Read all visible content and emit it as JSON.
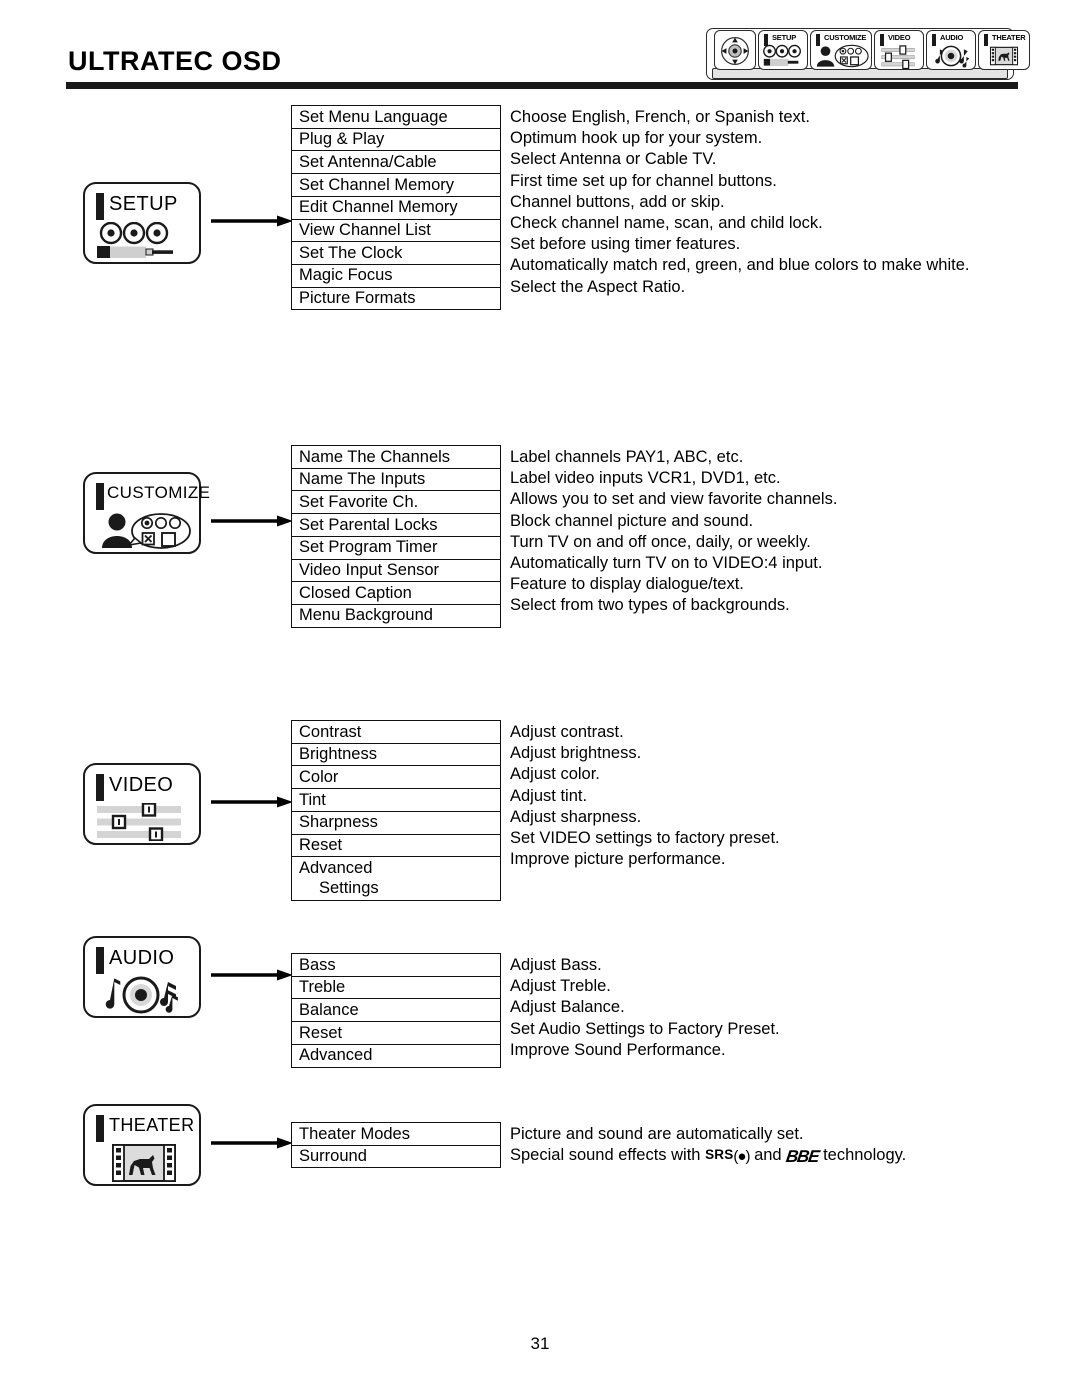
{
  "header": {
    "title": "ULTRATEC OSD"
  },
  "iconbar": {
    "name": "osd-navigation-bar",
    "tabs": [
      {
        "label": "",
        "icon": "dpad-icon"
      },
      {
        "label": "SETUP",
        "icon": "rca-jacks-cable-icon"
      },
      {
        "label": "CUSTOMIZE",
        "icon": "person-options-icon"
      },
      {
        "label": "VIDEO",
        "icon": "sliders-icon"
      },
      {
        "label": "AUDIO",
        "icon": "speaker-music-notes-icon"
      },
      {
        "label": "THEATER",
        "icon": "film-strip-horse-icon"
      }
    ]
  },
  "sections": [
    {
      "id": "setup",
      "icon_label": "SETUP",
      "icon_name": "rca-jacks-cable-icon",
      "items": [
        {
          "label": "Set Menu Language",
          "desc": "Choose English, French, or Spanish text."
        },
        {
          "label": "Plug & Play",
          "desc": "Optimum hook up for your system."
        },
        {
          "label": "Set Antenna/Cable",
          "desc": "Select Antenna or Cable TV."
        },
        {
          "label": "Set Channel Memory",
          "desc": "First time set up for channel buttons."
        },
        {
          "label": "Edit Channel Memory",
          "desc": "Channel buttons, add or skip."
        },
        {
          "label": "View Channel List",
          "desc": "Check channel name, scan, and child lock."
        },
        {
          "label": "Set The Clock",
          "desc": "Set before using timer features."
        },
        {
          "label": "Magic Focus",
          "desc": "Automatically match red, green, and blue colors to make white."
        },
        {
          "label": "Picture Formats",
          "desc": "Select  the Aspect Ratio."
        }
      ]
    },
    {
      "id": "customize",
      "icon_label": "CUSTOMIZE",
      "icon_name": "person-options-icon",
      "items": [
        {
          "label": "Name The Channels",
          "desc": "Label channels PAY1, ABC, etc."
        },
        {
          "label": "Name The Inputs",
          "desc": "Label video inputs VCR1, DVD1, etc."
        },
        {
          "label": "Set Favorite Ch.",
          "desc": "Allows you to set and view favorite channels."
        },
        {
          "label": "Set Parental Locks",
          "desc": "Block channel picture and sound."
        },
        {
          "label": "Set Program Timer",
          "desc": "Turn TV on and off once, daily, or weekly."
        },
        {
          "label": "Video Input Sensor",
          "desc": "Automatically turn TV on to VIDEO:4 input."
        },
        {
          "label": "Closed Caption",
          "desc": "Feature to display dialogue/text."
        },
        {
          "label": "Menu Background",
          "desc": "Select from two types of backgrounds."
        }
      ]
    },
    {
      "id": "video",
      "icon_label": "VIDEO",
      "icon_name": "sliders-icon",
      "items": [
        {
          "label": "Contrast",
          "desc": "Adjust contrast."
        },
        {
          "label": "Brightness",
          "desc": "Adjust brightness."
        },
        {
          "label": "Color",
          "desc": "Adjust color."
        },
        {
          "label": "Tint",
          "desc": "Adjust tint."
        },
        {
          "label": "Sharpness",
          "desc": "Adjust sharpness."
        },
        {
          "label": "Reset",
          "desc": "Set VIDEO settings to factory preset."
        },
        {
          "label": "Advanced",
          "label2": "Settings",
          "desc": "Improve picture performance."
        }
      ]
    },
    {
      "id": "audio",
      "icon_label": "AUDIO",
      "icon_name": "speaker-music-notes-icon",
      "items": [
        {
          "label": "Bass",
          "desc": "Adjust Bass."
        },
        {
          "label": "Treble",
          "desc": "Adjust Treble."
        },
        {
          "label": "Balance",
          "desc": "Adjust Balance."
        },
        {
          "label": "Reset",
          "desc": "Set Audio Settings to Factory Preset."
        },
        {
          "label": "Advanced",
          "desc": "Improve Sound Performance."
        }
      ]
    },
    {
      "id": "theater",
      "icon_label": "THEATER",
      "icon_name": "film-strip-horse-icon",
      "items": [
        {
          "label": "Theater Modes",
          "desc": "Picture and sound are automatically set."
        },
        {
          "label": "Surround",
          "desc_prefix": "Special sound effects with ",
          "srs_text": "SRS",
          "srs_mark": "(●)",
          "desc_mid": " and ",
          "bbe_text": "BBE",
          "desc_suffix": " technology."
        }
      ]
    }
  ],
  "footer": {
    "page_number": "31"
  }
}
